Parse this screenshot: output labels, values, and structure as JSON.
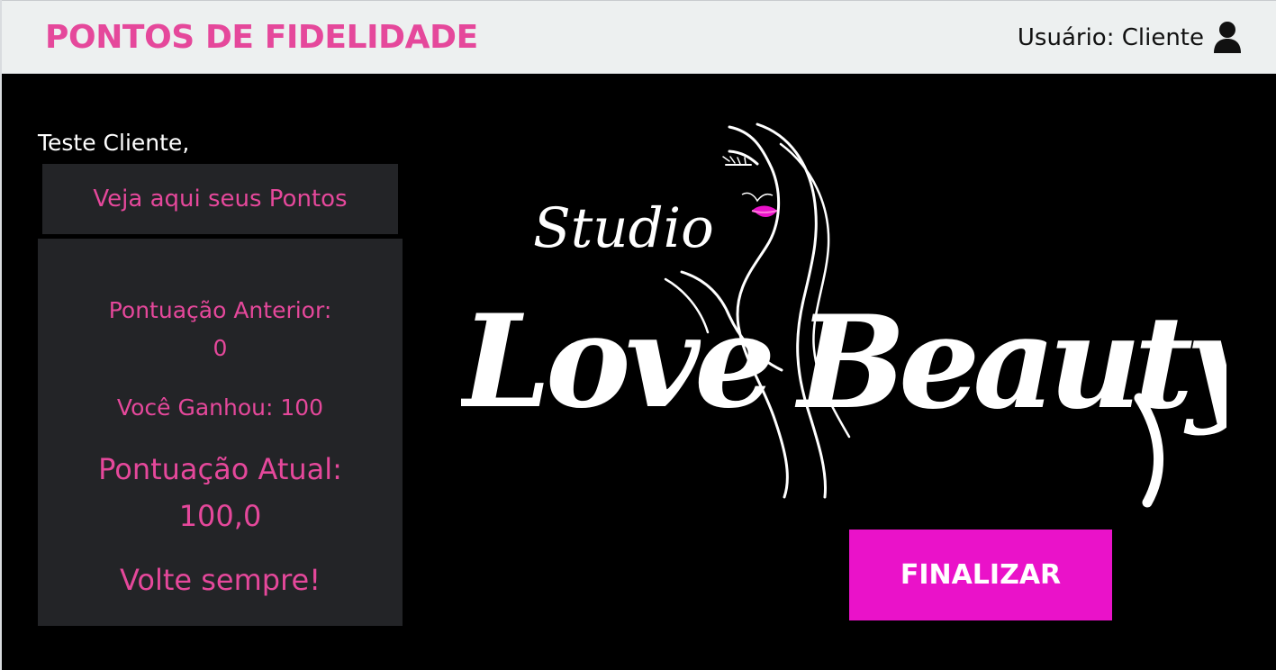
{
  "header": {
    "title": "PONTOS DE FIDELIDADE",
    "user_label": "Usuário: Cliente",
    "user_icon": "user-icon"
  },
  "customer": {
    "greeting": "Teste Cliente,"
  },
  "points": {
    "link_label": "Veja aqui seus Pontos",
    "previous_label": "Pontuação Anterior:",
    "previous_value": "0",
    "gain_text": "Você Ganhou: 100",
    "current_label": "Pontuação Atual:",
    "current_value": "100,0",
    "goodbye": "Volte sempre!"
  },
  "logo": {
    "top_text": "Studio",
    "main_left": "Love",
    "main_right": "Beauty"
  },
  "actions": {
    "finish_label": "FINALIZAR"
  },
  "colors": {
    "brand_pink": "#e5489b",
    "button_magenta": "#ea12c9",
    "panel_gray": "#232427",
    "header_background": "#edf0f0",
    "background": "#000000"
  }
}
